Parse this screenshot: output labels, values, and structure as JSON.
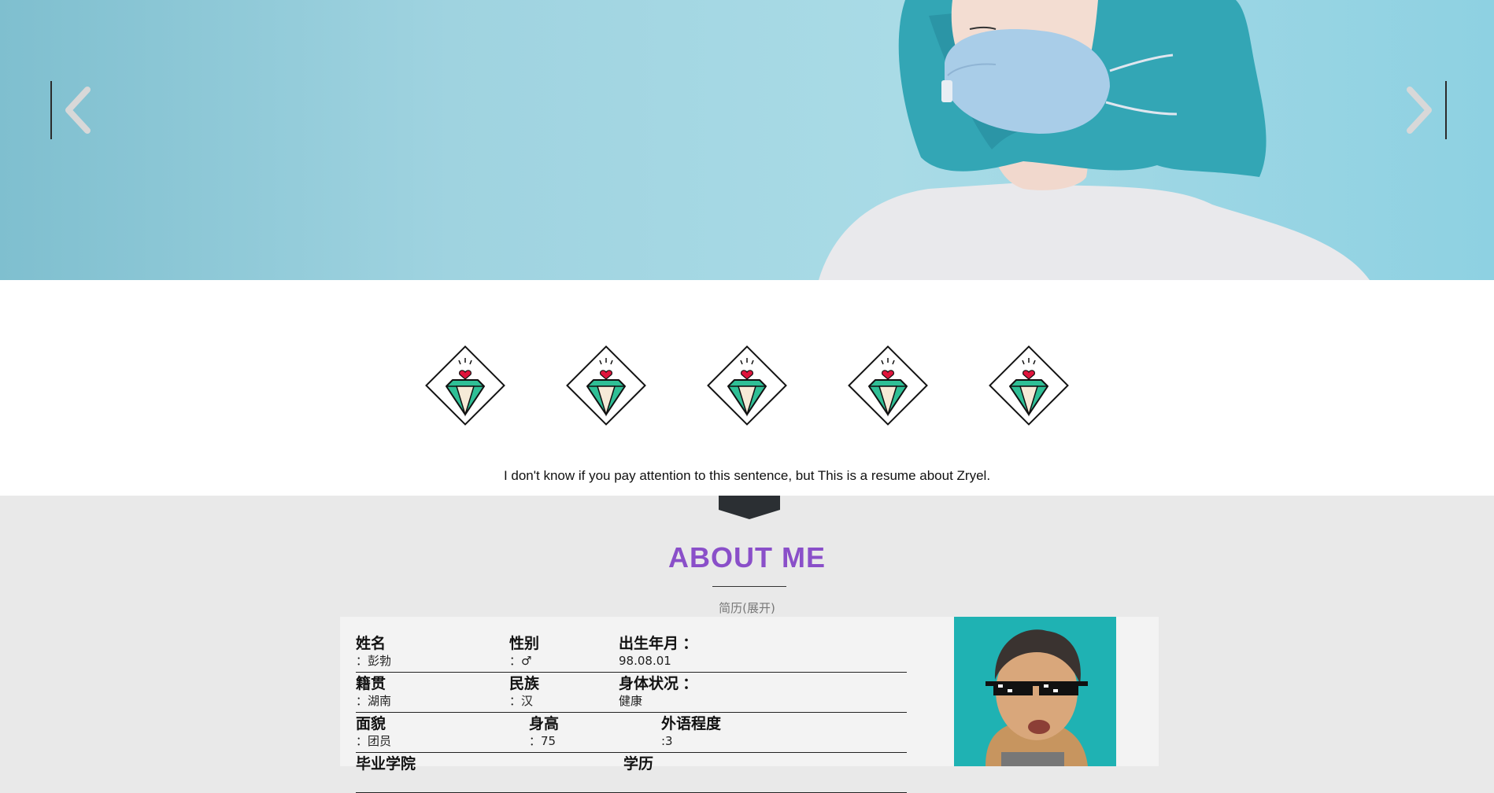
{
  "hero": {
    "prev_glyph": "‹",
    "next_glyph": "›"
  },
  "tagline": "I don't know if you pay attention to this sentence, but This is a resume about Zryel.",
  "icons": [
    "diamond-heart-icon",
    "diamond-heart-icon",
    "diamond-heart-icon",
    "diamond-heart-icon",
    "diamond-heart-icon"
  ],
  "about": {
    "title": "ABOUT ME",
    "subtitle": "简历(展开)",
    "rows": [
      [
        {
          "label": "姓名",
          "value": "：彭勃"
        },
        {
          "label": "性别",
          "value": "：♂"
        },
        {
          "label": "出生年月 ：",
          "value": "98.08.01"
        }
      ],
      [
        {
          "label": "籍贯",
          "value": "：湖南"
        },
        {
          "label": "民族",
          "value": "：汉"
        },
        {
          "label": "身体状况 ：",
          "value": "健康"
        }
      ],
      [
        {
          "label": "面貌",
          "value": "：团员"
        },
        {
          "label": "身高",
          "value": "：75"
        },
        {
          "label": "外语程度",
          "value": ":3"
        }
      ],
      [
        {
          "label": "毕业学院",
          "value": ""
        },
        {
          "label": "学历",
          "value": ""
        }
      ]
    ]
  },
  "colors": {
    "accent": "#8a4fc9",
    "diamond_green": "#2fbf96",
    "heart_red": "#e0143c",
    "hero_blue": "#9fd3e0"
  }
}
